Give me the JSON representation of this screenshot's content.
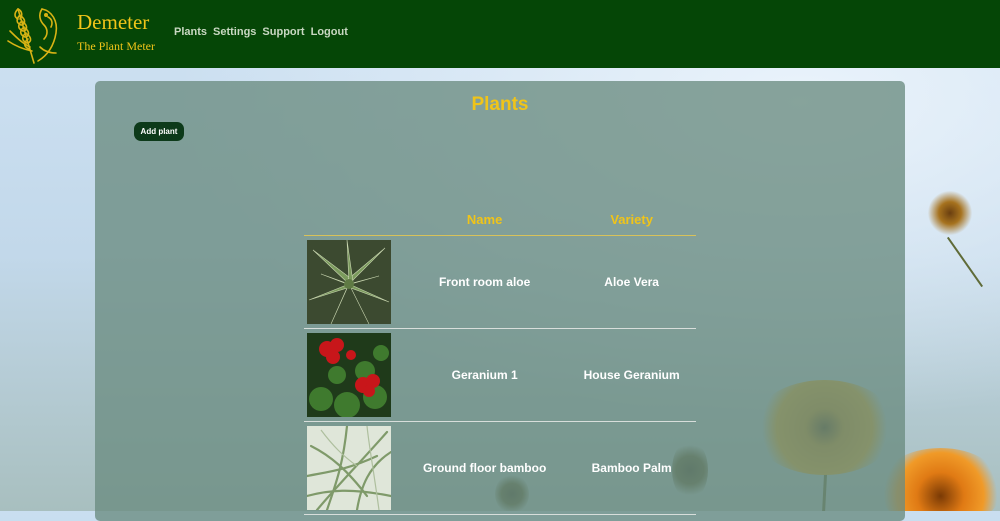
{
  "header": {
    "brand_title": "Demeter",
    "brand_subtitle": "The Plant Meter",
    "nav": [
      "Plants",
      "Settings",
      "Support",
      "Logout"
    ]
  },
  "panel": {
    "title": "Plants",
    "add_button": "Add plant"
  },
  "table": {
    "columns": [
      "",
      "Name",
      "Variety"
    ],
    "rows": [
      {
        "name": "Front room aloe",
        "variety": "Aloe Vera",
        "image": "aloe-photo"
      },
      {
        "name": "Geranium 1",
        "variety": "House Geranium",
        "image": "geranium-photo"
      },
      {
        "name": "Ground floor bamboo",
        "variety": "Bamboo Palm",
        "image": "bamboo-palm-photo"
      }
    ]
  },
  "colors": {
    "header_bg": "#054606",
    "accent": "#f0c419",
    "button_bg": "#0d3a1a"
  }
}
